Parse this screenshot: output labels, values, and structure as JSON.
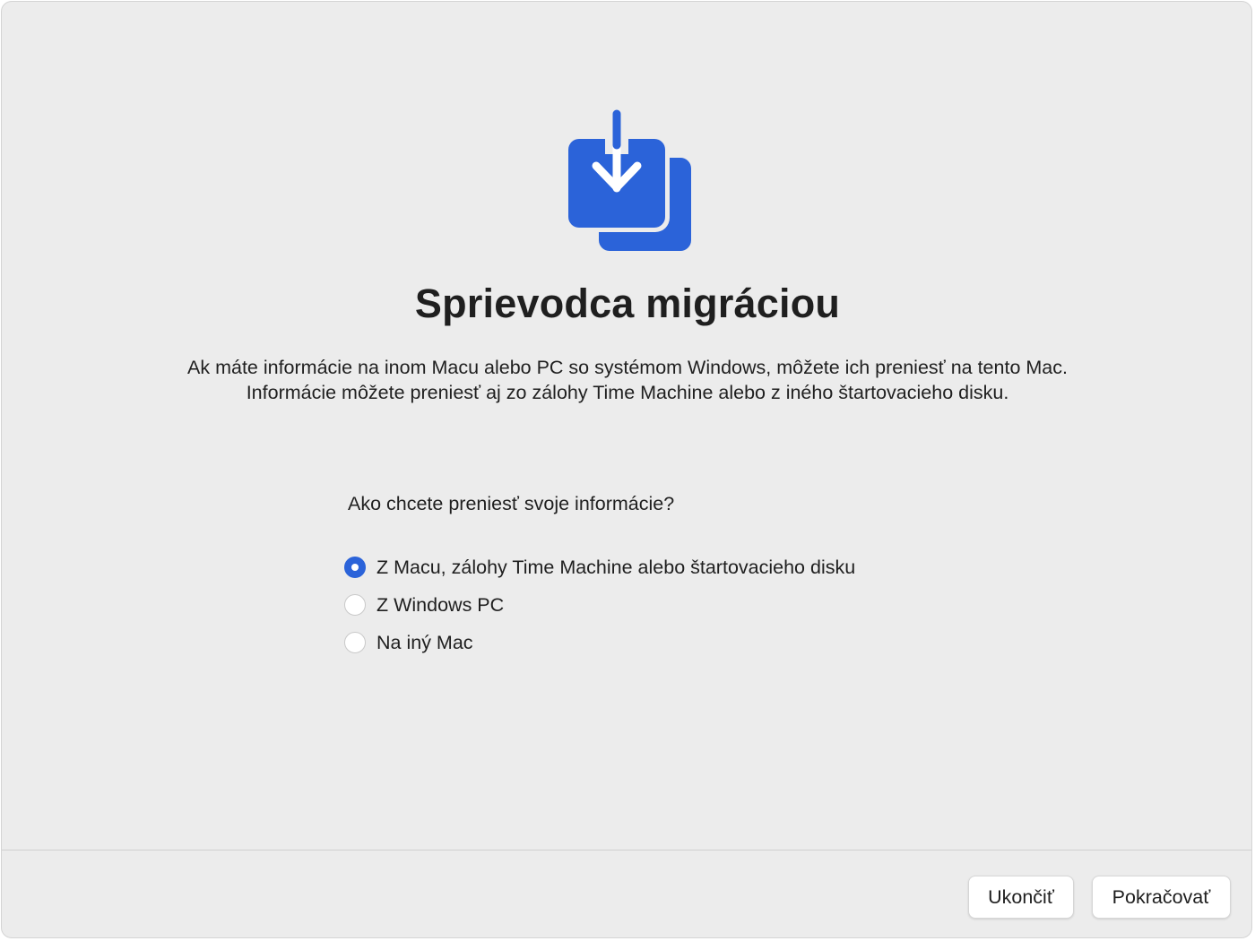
{
  "app": {
    "title": "Sprievodca migráciou",
    "icon": "migration-assistant-icon",
    "accent_color": "#2b63d9"
  },
  "description": {
    "line1": "Ak máte informácie na inom Macu alebo PC so systémom Windows, môžete ich preniesť na tento Mac.",
    "line2": "Informácie môžete preniesť aj zo zálohy Time Machine alebo z iného štartovacieho disku."
  },
  "transfer": {
    "question": "Ako chcete preniesť svoje informácie?",
    "options": [
      {
        "label": "Z Macu, zálohy Time Machine alebo štartovacieho disku",
        "selected": true
      },
      {
        "label": "Z Windows PC",
        "selected": false
      },
      {
        "label": "Na iný Mac",
        "selected": false
      }
    ]
  },
  "footer": {
    "quit_label": "Ukončiť",
    "continue_label": "Pokračovať"
  }
}
